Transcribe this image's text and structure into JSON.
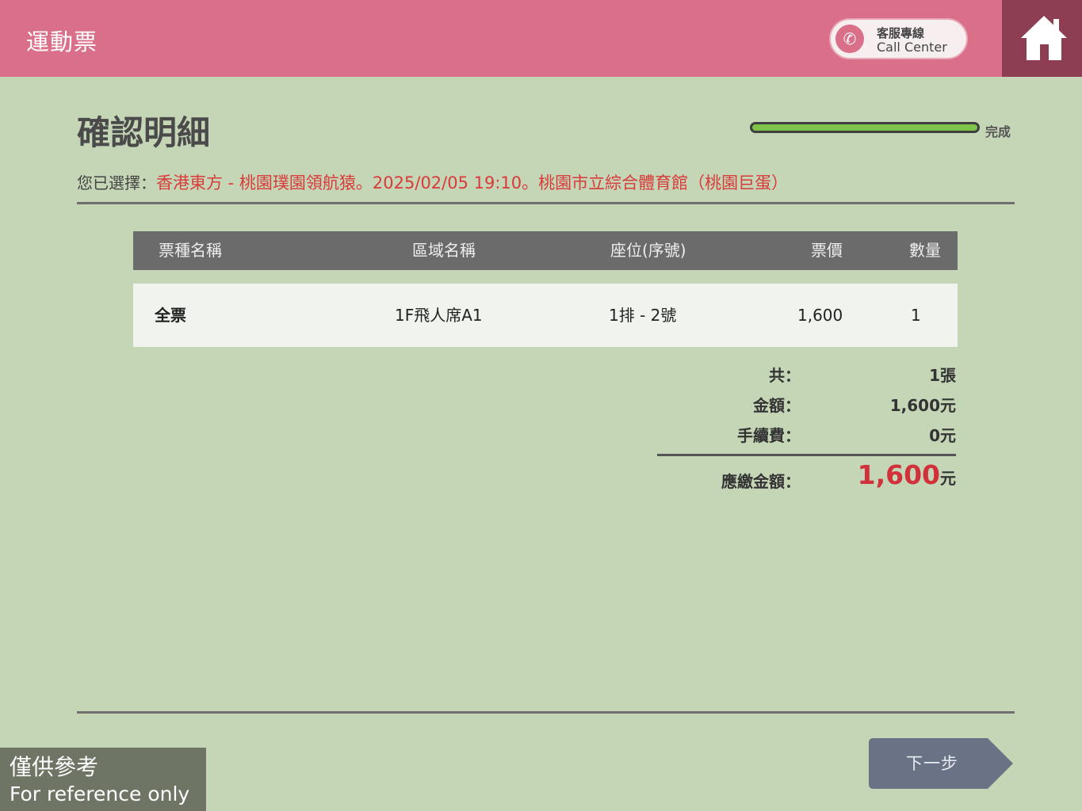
{
  "header": {
    "title": "運動票",
    "call_center_zh": "客服專線",
    "call_center_en": "Call Center"
  },
  "page": {
    "title": "確認明細",
    "progress_label": "完成",
    "progress_fraction": 1.0
  },
  "selection": {
    "label": "您已選擇：",
    "value": "香港東方 - 桃園璞園領航猿。2025/02/05 19:10。桃園市立綜合體育館（桃園巨蛋）"
  },
  "table": {
    "headers": [
      "票種名稱",
      "區域名稱",
      "座位(序號)",
      "票價",
      "數量"
    ],
    "rows": [
      [
        "全票",
        "1F飛人席A1",
        "1排 - 2號",
        "1,600",
        "1"
      ]
    ]
  },
  "summary": {
    "count_label": "共：",
    "count_value": "1張",
    "amount_label": "金額：",
    "amount_value": "1,600元",
    "fee_label": "手續費：",
    "fee_value": "0元",
    "total_label": "應繳金額：",
    "total_value": "1,600",
    "total_unit": "元"
  },
  "actions": {
    "next_label": "下一步"
  },
  "watermark": {
    "line1": "僅供參考",
    "line2": "For reference only"
  },
  "colors": {
    "header": "#d96f88",
    "home": "#8e3e52",
    "background": "#c5d6b6",
    "accent_red": "#d93a3a",
    "progress": "#7ec34a"
  }
}
